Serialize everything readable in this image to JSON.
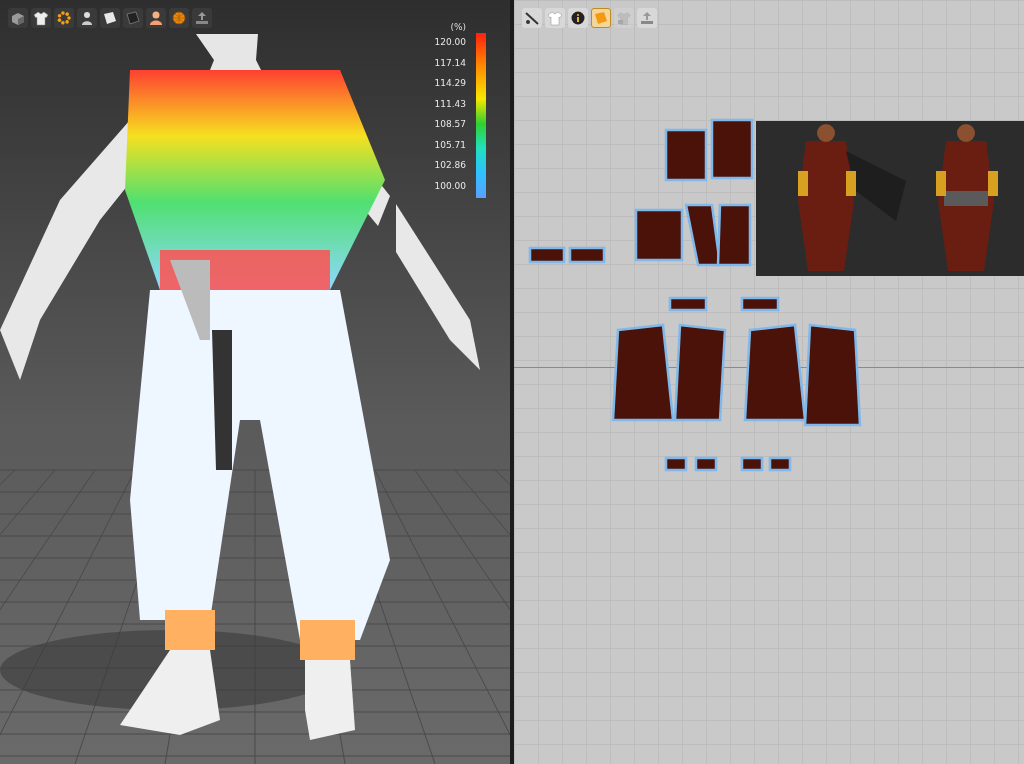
{
  "viewport_3d": {
    "toolbar": [
      {
        "kind": "cube"
      },
      {
        "kind": "shirt"
      },
      {
        "kind": "dots"
      },
      {
        "kind": "person"
      },
      {
        "kind": "sheet"
      },
      {
        "kind": "dark-sheet"
      },
      {
        "kind": "avatar"
      },
      {
        "kind": "globe"
      },
      {
        "kind": "upload"
      }
    ],
    "legend": {
      "unit": "(%)",
      "ticks": [
        "120.00",
        "117.14",
        "114.29",
        "111.43",
        "108.57",
        "105.71",
        "102.86",
        "100.00"
      ]
    }
  },
  "viewport_2d": {
    "toolbar": [
      {
        "kind": "needle",
        "selected": false,
        "disabled": false
      },
      {
        "kind": "shirt",
        "selected": false,
        "disabled": false
      },
      {
        "kind": "info",
        "selected": false,
        "disabled": false
      },
      {
        "kind": "sheet",
        "selected": true,
        "disabled": false
      },
      {
        "kind": "lock-shirt",
        "selected": false,
        "disabled": true
      },
      {
        "kind": "upload",
        "selected": false,
        "disabled": false
      }
    ]
  }
}
